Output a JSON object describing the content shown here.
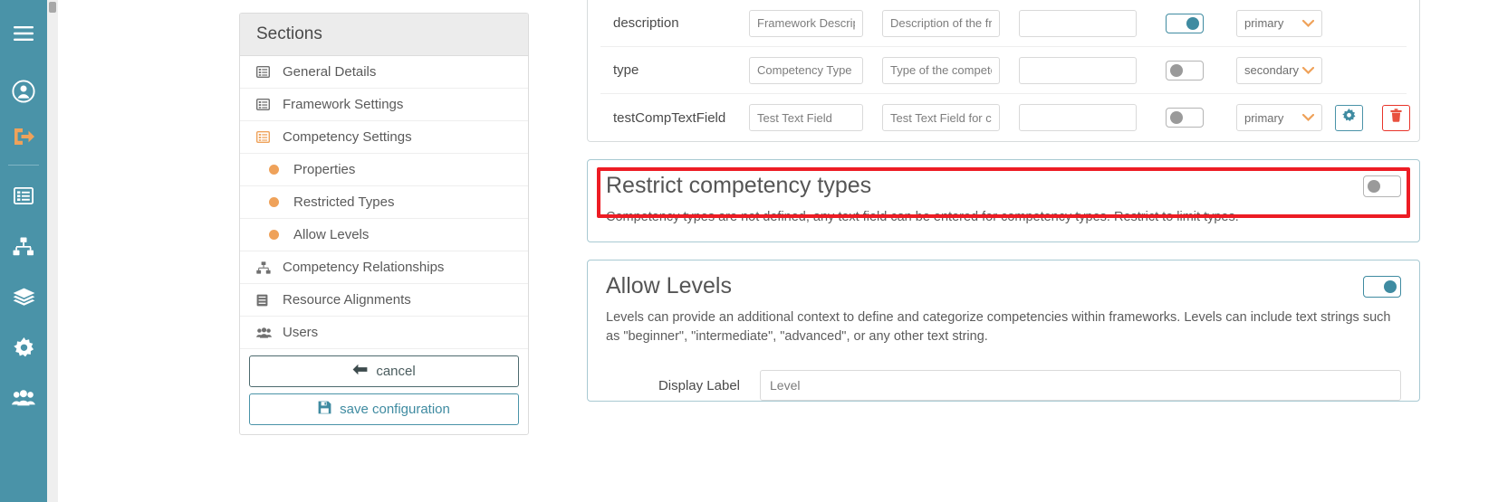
{
  "colors": {
    "rail": "#4a93a8",
    "accent_orange": "#efa25a",
    "teal": "#3f8ba1",
    "highlight_red": "#ed1c24",
    "danger": "#e8342a"
  },
  "rail": {
    "items": [
      {
        "icon": "hamburger-menu-icon",
        "name": "menu-toggle"
      },
      {
        "icon": "user-circle-icon",
        "name": "account"
      },
      {
        "icon": "logout-icon",
        "name": "logout"
      },
      {
        "icon": "list-icon",
        "name": "frameworks"
      },
      {
        "icon": "sitemap-icon",
        "name": "relationships"
      },
      {
        "icon": "layers-icon",
        "name": "layers"
      },
      {
        "icon": "gear-icon",
        "name": "settings"
      },
      {
        "icon": "users-icon",
        "name": "users"
      }
    ]
  },
  "sections": {
    "header": "Sections",
    "items": [
      {
        "label": "General Details",
        "icon": "list-alt-icon",
        "active": false,
        "sub": false
      },
      {
        "label": "Framework Settings",
        "icon": "list-alt-icon",
        "active": false,
        "sub": false
      },
      {
        "label": "Competency Settings",
        "icon": "list-alt-icon",
        "active": true,
        "sub": false
      },
      {
        "label": "Properties",
        "icon": "dot-icon",
        "active": false,
        "sub": true
      },
      {
        "label": "Restricted Types",
        "icon": "dot-icon",
        "active": false,
        "sub": true
      },
      {
        "label": "Allow Levels",
        "icon": "dot-icon",
        "active": false,
        "sub": true
      },
      {
        "label": "Competency Relationships",
        "icon": "sitemap-icon",
        "active": false,
        "sub": false
      },
      {
        "label": "Resource Alignments",
        "icon": "book-icon",
        "active": false,
        "sub": false
      },
      {
        "label": "Users",
        "icon": "users-icon",
        "active": false,
        "sub": false
      }
    ],
    "cancel_label": "cancel",
    "save_label": "save configuration"
  },
  "property_table": {
    "rows": [
      {
        "name": "description",
        "field1": "Framework Description",
        "field2": "Description of the framework",
        "field3": "",
        "toggle_on": true,
        "select_value": "primary",
        "has_actions": false
      },
      {
        "name": "type",
        "field1": "Competency Type",
        "field2": "Type of the competency",
        "field3": "",
        "toggle_on": false,
        "select_value": "secondary",
        "has_actions": false
      },
      {
        "name": "testCompTextField",
        "field1": "Test Text Field",
        "field2": "Test Text Field for competency",
        "field3": "",
        "toggle_on": false,
        "select_value": "primary",
        "has_actions": true
      }
    ]
  },
  "restrict_panel": {
    "title": "Restrict competency types",
    "description": "Competency types are not defined, any text field can be entered for competency types. Restrict to limit types.",
    "toggle_on": false,
    "highlighted": true
  },
  "allow_levels_panel": {
    "title": "Allow Levels",
    "description": "Levels can provide an additional context to define and categorize competencies within frameworks. Levels can include text strings such as \"beginner\", \"intermediate\", \"advanced\", or any other text string.",
    "toggle_on": true,
    "display_label_caption": "Display Label",
    "display_label_value": "Level"
  }
}
